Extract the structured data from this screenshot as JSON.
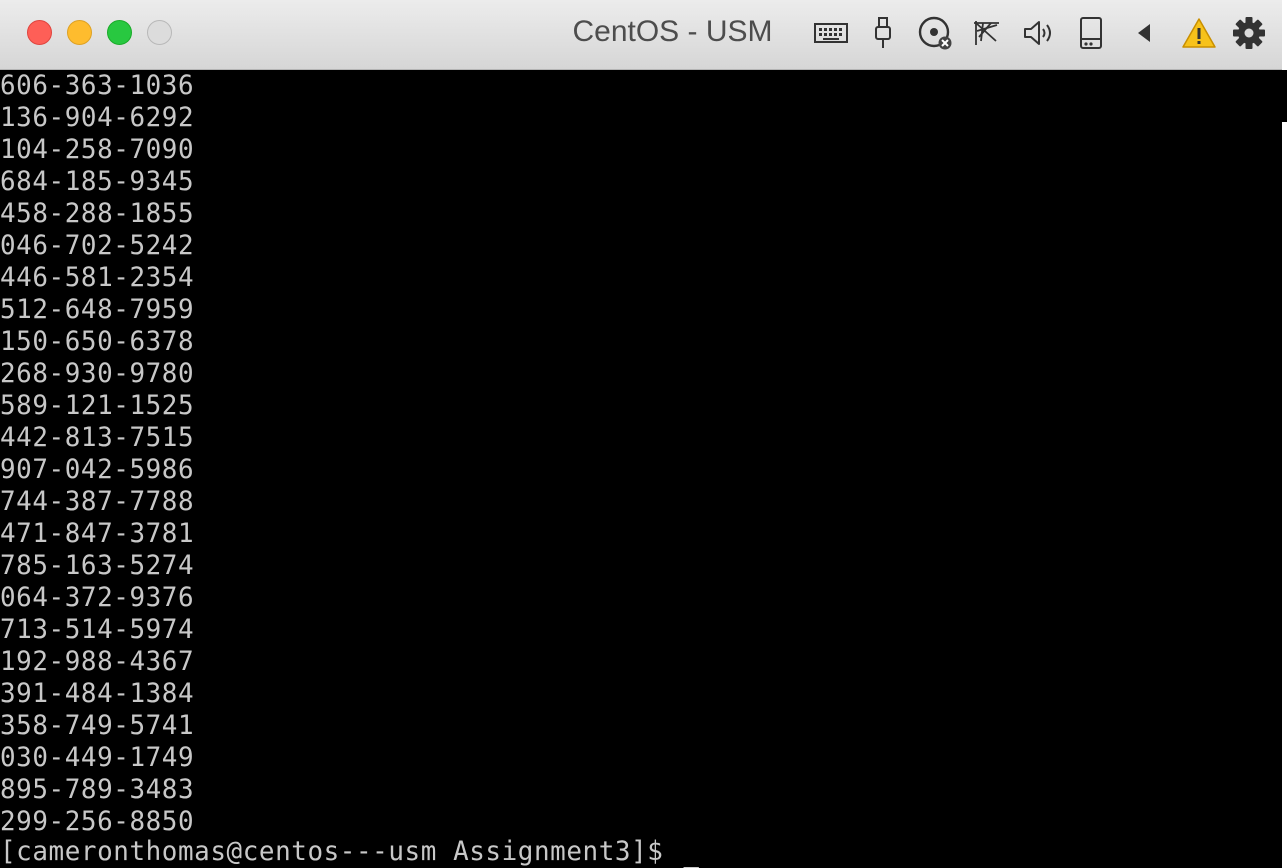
{
  "window": {
    "title": "CentOS - USM"
  },
  "toolbar_icons": [
    "keyboard-icon",
    "usb-icon",
    "optical-disc-icon",
    "network-icon",
    "speaker-icon",
    "storage-icon",
    "arrow-left-icon",
    "warning-icon",
    "gear-icon"
  ],
  "terminal": {
    "lines": [
      "606-363-1036",
      "136-904-6292",
      "104-258-7090",
      "684-185-9345",
      "458-288-1855",
      "046-702-5242",
      "446-581-2354",
      "512-648-7959",
      "150-650-6378",
      "268-930-9780",
      "589-121-1525",
      "442-813-7515",
      "907-042-5986",
      "744-387-7788",
      "471-847-3781",
      "785-163-5274",
      "064-372-9376",
      "713-514-5974",
      "192-988-4367",
      "391-484-1384",
      "358-749-5741",
      "030-449-1749",
      "895-789-3483",
      "299-256-8850"
    ],
    "prompt": "[cameronthomas@centos---usm Assignment3]$ "
  },
  "colors": {
    "terminal_bg": "#000000",
    "terminal_fg": "#c8c8c8",
    "warning": "#f7c21a",
    "close": "#fe5f57",
    "minimize": "#febc2e",
    "maximize": "#28c840"
  }
}
